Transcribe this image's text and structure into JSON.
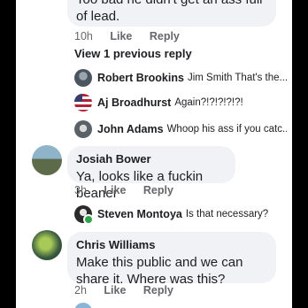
{
  "top_comment": {
    "text": "Too bad he didn't get an ass full of lead.",
    "time": "10h",
    "like": "Like",
    "reply": "Reply"
  },
  "view_previous": "View 1 previous reply",
  "replies": [
    {
      "name": "Robert Brookins",
      "text": "Jim Smith That's the..."
    },
    {
      "name": "Aj Broadhurst",
      "text": "Again?!?!?!?!?!"
    },
    {
      "name": "John Adams",
      "text": "Whoop his ass if you catc..."
    }
  ],
  "comment_josiah": {
    "name": "Josiah Bower",
    "text": "Ya, looks like a fuckin beaner",
    "time": "3h",
    "like": "Like",
    "reply": "Reply"
  },
  "reply_steven": {
    "name": "Steven Montoya",
    "text": "Is that necessary?"
  },
  "comment_chris": {
    "name": "Chris Williams",
    "text": "Make this public and we can share it. Where was this?",
    "time": "2h",
    "like": "Like",
    "reply": "Reply"
  },
  "colors": {
    "bubble": "#f0f2f5",
    "meta": "#65676b",
    "online": "#31a24c"
  }
}
